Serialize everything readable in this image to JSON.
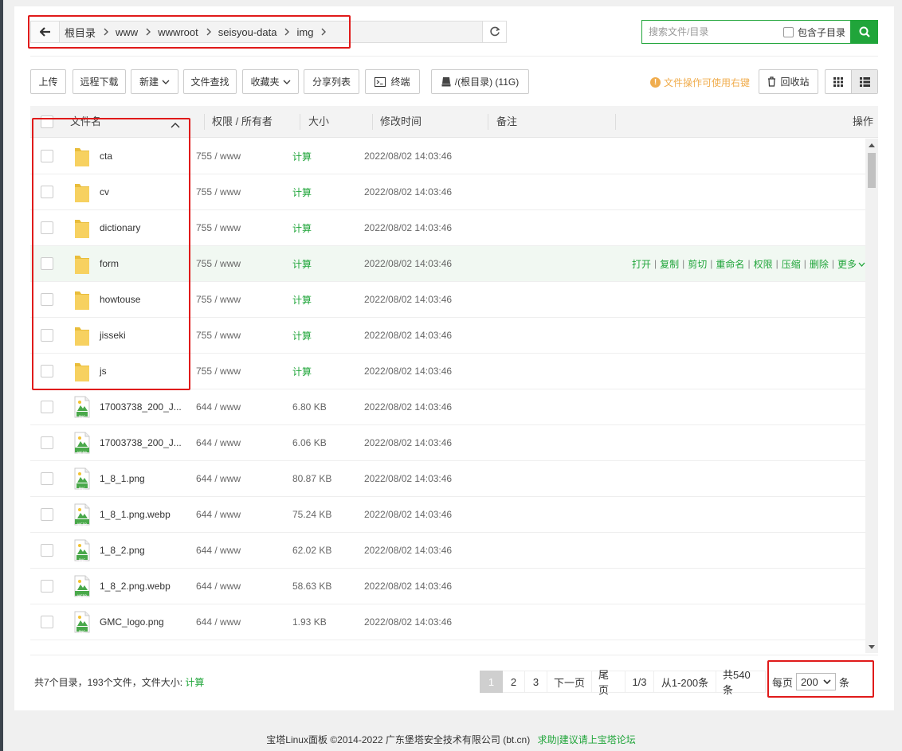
{
  "breadcrumb": {
    "items": [
      "根目录",
      "www",
      "wwwroot",
      "seisyou-data",
      "img"
    ]
  },
  "search": {
    "placeholder": "搜索文件/目录",
    "include_subdir_label": "包含子目录"
  },
  "toolbar": {
    "upload": "上传",
    "remote_download": "远程下载",
    "new": "新建",
    "file_search": "文件查找",
    "favorites": "收藏夹",
    "share_list": "分享列表",
    "terminal": "终端",
    "disk": "/(根目录) (11G)",
    "hint": "文件操作可使用右键",
    "recycle_bin": "回收站"
  },
  "table": {
    "headers": {
      "name": "文件名",
      "perm": "权限 / 所有者",
      "size": "大小",
      "mtime": "修改时间",
      "remark": "备注",
      "ops": "操作"
    },
    "rows": [
      {
        "name": "cta",
        "icon": "folder-icon",
        "perm": "755 / www",
        "size": "计算",
        "mtime": "2022/08/02 14:03:46"
      },
      {
        "name": "cv",
        "icon": "folder-icon",
        "perm": "755 / www",
        "size": "计算",
        "mtime": "2022/08/02 14:03:46"
      },
      {
        "name": "dictionary",
        "icon": "folder-icon",
        "perm": "755 / www",
        "size": "计算",
        "mtime": "2022/08/02 14:03:46"
      },
      {
        "name": "form",
        "icon": "folder-icon",
        "perm": "755 / www",
        "size": "计算",
        "mtime": "2022/08/02 14:03:46"
      },
      {
        "name": "howtouse",
        "icon": "folder-icon",
        "perm": "755 / www",
        "size": "计算",
        "mtime": "2022/08/02 14:03:46"
      },
      {
        "name": "jisseki",
        "icon": "folder-icon",
        "perm": "755 / www",
        "size": "计算",
        "mtime": "2022/08/02 14:03:46"
      },
      {
        "name": "js",
        "icon": "folder-icon",
        "perm": "755 / www",
        "size": "计算",
        "mtime": "2022/08/02 14:03:46"
      },
      {
        "name": "17003738_200_J...",
        "icon": "png-file-icon",
        "badge": "PNG",
        "perm": "644 / www",
        "size": "6.80 KB",
        "mtime": "2022/08/02 14:03:46"
      },
      {
        "name": "17003738_200_J...",
        "icon": "webp-file-icon",
        "badge": "WEBP",
        "perm": "644 / www",
        "size": "6.06 KB",
        "mtime": "2022/08/02 14:03:46"
      },
      {
        "name": "1_8_1.png",
        "icon": "png-file-icon",
        "badge": "PNG",
        "perm": "644 / www",
        "size": "80.87 KB",
        "mtime": "2022/08/02 14:03:46"
      },
      {
        "name": "1_8_1.png.webp",
        "icon": "webp-file-icon",
        "badge": "WEBP",
        "perm": "644 / www",
        "size": "75.24 KB",
        "mtime": "2022/08/02 14:03:46"
      },
      {
        "name": "1_8_2.png",
        "icon": "png-file-icon",
        "badge": "PNG",
        "perm": "644 / www",
        "size": "62.02 KB",
        "mtime": "2022/08/02 14:03:46"
      },
      {
        "name": "1_8_2.png.webp",
        "icon": "webp-file-icon",
        "badge": "WEBP",
        "perm": "644 / www",
        "size": "58.63 KB",
        "mtime": "2022/08/02 14:03:46"
      },
      {
        "name": "GMC_logo.png",
        "icon": "png-file-icon",
        "badge": "PNG",
        "perm": "644 / www",
        "size": "1.93 KB",
        "mtime": "2022/08/02 14:03:46"
      }
    ],
    "hover_row_ops": [
      "打开",
      "复制",
      "剪切",
      "重命名",
      "权限",
      "压缩",
      "删除",
      "更多"
    ]
  },
  "summary": {
    "text": "共7个目录，193个文件，文件大小:",
    "calc_link": "计算"
  },
  "pagination": {
    "pages": [
      "1",
      "2",
      "3"
    ],
    "current": "1",
    "next": "下一页",
    "last": "尾页",
    "page_of": "1/3",
    "range": "从1-200条",
    "total": "共540条",
    "per_page_label": "每页",
    "per_page_value": "200",
    "per_page_unit": "条"
  },
  "footer": {
    "copyright": "宝塔Linux面板 ©2014-2022 广东堡塔安全技术有限公司 (bt.cn)",
    "forum_link": "求助|建议请上宝塔论坛"
  },
  "colors": {
    "accent": "#20a53a",
    "highlight_box": "#e01a1a",
    "hint": "#f0ad4e",
    "folder": "#f7d160"
  }
}
